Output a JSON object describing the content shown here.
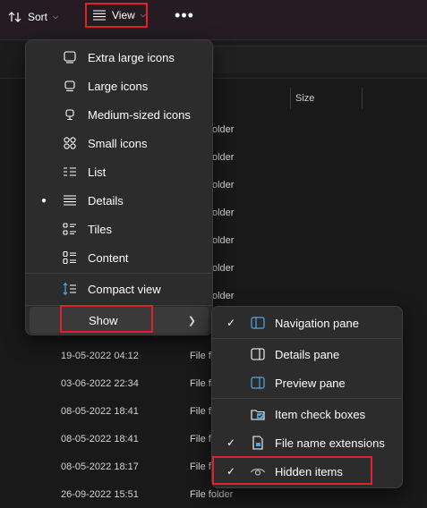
{
  "toolbar": {
    "sort_label": "Sort",
    "view_label": "View"
  },
  "list": {
    "size_header": "Size",
    "partial_rows": [
      {
        "type": "older"
      },
      {
        "type": "older"
      },
      {
        "type": "older"
      },
      {
        "type": "older"
      },
      {
        "type": "older"
      },
      {
        "type": "older"
      },
      {
        "type": "older"
      }
    ],
    "rows": [
      {
        "date": "19-05-2022 04:12",
        "type": "File f"
      },
      {
        "date": "03-06-2022 22:34",
        "type": "File f"
      },
      {
        "date": "08-05-2022 18:41",
        "type": "File f"
      },
      {
        "date": "08-05-2022 18:41",
        "type": "File f"
      },
      {
        "date": "08-05-2022 18:17",
        "type": "File f"
      },
      {
        "date": "26-09-2022 15:51",
        "type": "File folder"
      }
    ]
  },
  "view_menu": {
    "items": [
      {
        "label": "Extra large icons",
        "icon": "monitor-icon"
      },
      {
        "label": "Large icons",
        "icon": "monitor-icon"
      },
      {
        "label": "Medium-sized icons",
        "icon": "monitor-stand-icon"
      },
      {
        "label": "Small icons",
        "icon": "grid-icon"
      },
      {
        "label": "List",
        "icon": "list-icon"
      },
      {
        "label": "Details",
        "icon": "details-icon",
        "selected": true
      },
      {
        "label": "Tiles",
        "icon": "tiles-icon"
      },
      {
        "label": "Content",
        "icon": "content-icon"
      },
      {
        "label": "Compact view",
        "icon": "compact-icon"
      },
      {
        "label": "Show",
        "icon": "",
        "submenu": true
      }
    ]
  },
  "show_menu": {
    "items": [
      {
        "label": "Navigation pane",
        "icon": "navigation-pane-icon",
        "checked": true
      },
      {
        "label": "Details pane",
        "icon": "details-pane-icon",
        "checked": false
      },
      {
        "label": "Preview pane",
        "icon": "preview-pane-icon",
        "checked": false
      },
      {
        "label": "Item check boxes",
        "icon": "checkbox-icon",
        "checked": false
      },
      {
        "label": "File name extensions",
        "icon": "file-icon",
        "checked": true
      },
      {
        "label": "Hidden items",
        "icon": "eye-icon",
        "checked": true
      }
    ]
  },
  "colors": {
    "highlight": "#e0202a",
    "accent": "#4fa7e8",
    "menu_bg": "#2c2c2c",
    "toolbar_bg": "#241b23"
  }
}
